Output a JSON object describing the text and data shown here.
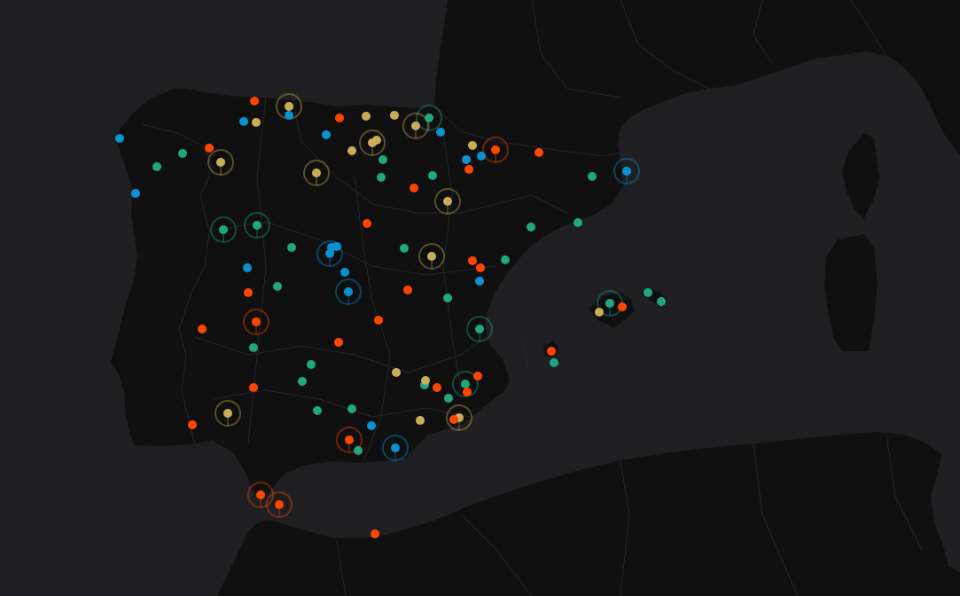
{
  "map": {
    "pins": [
      {
        "color": "#ff4500",
        "highlighted": false
      },
      {
        "color": "#c9ad57",
        "highlighted": true
      },
      {
        "color": "#0b93d1",
        "highlighted": false
      },
      {
        "color": "#c9ad57",
        "highlighted": false
      },
      {
        "color": "#c9ad57",
        "highlighted": false
      },
      {
        "color": "#ff4500",
        "highlighted": false
      },
      {
        "color": "#22a67d",
        "highlighted": true
      },
      {
        "color": "#0b93d1",
        "highlighted": false
      },
      {
        "color": "#c9ad57",
        "highlighted": false
      },
      {
        "color": "#c9ad57",
        "highlighted": true
      },
      {
        "color": "#0b93d1",
        "highlighted": false
      },
      {
        "color": "#0b93d1",
        "highlighted": false
      },
      {
        "color": "#0b93d1",
        "highlighted": false
      },
      {
        "color": "#c9ad57",
        "highlighted": false
      },
      {
        "color": "#c9ad57",
        "highlighted": true
      },
      {
        "color": "#c9ad57",
        "highlighted": false
      },
      {
        "color": "#ff4500",
        "highlighted": false
      },
      {
        "color": "#ff4500",
        "highlighted": true
      },
      {
        "color": "#c9ad57",
        "highlighted": false
      },
      {
        "color": "#ff4500",
        "highlighted": false
      },
      {
        "color": "#22a67d",
        "highlighted": false
      },
      {
        "color": "#0b93d1",
        "highlighted": false
      },
      {
        "color": "#22a67d",
        "highlighted": false
      },
      {
        "color": "#0b93d1",
        "highlighted": false
      },
      {
        "color": "#c9ad57",
        "highlighted": true
      },
      {
        "color": "#22a67d",
        "highlighted": false
      },
      {
        "color": "#ff4500",
        "highlighted": false
      },
      {
        "color": "#0b93d1",
        "highlighted": true
      },
      {
        "color": "#c9ad57",
        "highlighted": true
      },
      {
        "color": "#22a67d",
        "highlighted": false
      },
      {
        "color": "#22a67d",
        "highlighted": false
      },
      {
        "color": "#22a67d",
        "highlighted": false
      },
      {
        "color": "#ff4500",
        "highlighted": false
      },
      {
        "color": "#0b93d1",
        "highlighted": false
      },
      {
        "color": "#c9ad57",
        "highlighted": true
      },
      {
        "color": "#22a67d",
        "highlighted": false
      },
      {
        "color": "#ff4500",
        "highlighted": false
      },
      {
        "color": "#22a67d",
        "highlighted": true
      },
      {
        "color": "#22a67d",
        "highlighted": false
      },
      {
        "color": "#22a67d",
        "highlighted": true
      },
      {
        "color": "#0b93d1",
        "highlighted": false
      },
      {
        "color": "#0b93d1",
        "highlighted": false
      },
      {
        "color": "#22a67d",
        "highlighted": false
      },
      {
        "color": "#22a67d",
        "highlighted": false
      },
      {
        "color": "#0b93d1",
        "highlighted": true
      },
      {
        "color": "#c9ad57",
        "highlighted": true
      },
      {
        "color": "#ff4500",
        "highlighted": false
      },
      {
        "color": "#22a67d",
        "highlighted": false
      },
      {
        "color": "#ff4500",
        "highlighted": false
      },
      {
        "color": "#0b93d1",
        "highlighted": false
      },
      {
        "color": "#0b93d1",
        "highlighted": false
      },
      {
        "color": "#0b93d1",
        "highlighted": false
      },
      {
        "color": "#22a67d",
        "highlighted": false
      },
      {
        "color": "#ff4500",
        "highlighted": false
      },
      {
        "color": "#0b93d1",
        "highlighted": true
      },
      {
        "color": "#ff4500",
        "highlighted": false
      },
      {
        "color": "#22a67d",
        "highlighted": false
      },
      {
        "color": "#22a67d",
        "highlighted": false
      },
      {
        "color": "#22a67d",
        "highlighted": false
      },
      {
        "color": "#22a67d",
        "highlighted": true
      },
      {
        "color": "#ff4500",
        "highlighted": false
      },
      {
        "color": "#c9ad57",
        "highlighted": false
      },
      {
        "color": "#ff4500",
        "highlighted": false
      },
      {
        "color": "#ff4500",
        "highlighted": true
      },
      {
        "color": "#ff4500",
        "highlighted": false
      },
      {
        "color": "#22a67d",
        "highlighted": true
      },
      {
        "color": "#ff4500",
        "highlighted": false
      },
      {
        "color": "#22a67d",
        "highlighted": false
      },
      {
        "color": "#ff4500",
        "highlighted": false
      },
      {
        "color": "#22a67d",
        "highlighted": false
      },
      {
        "color": "#22a67d",
        "highlighted": false
      },
      {
        "color": "#c9ad57",
        "highlighted": false
      },
      {
        "color": "#ff4500",
        "highlighted": false
      },
      {
        "color": "#22a67d",
        "highlighted": false
      },
      {
        "color": "#c9ad57",
        "highlighted": false
      },
      {
        "color": "#22a67d",
        "highlighted": false
      },
      {
        "color": "#22a67d",
        "highlighted": true
      },
      {
        "color": "#ff4500",
        "highlighted": false
      },
      {
        "color": "#ff4500",
        "highlighted": false
      },
      {
        "color": "#ff4500",
        "highlighted": false
      },
      {
        "color": "#22a67d",
        "highlighted": false
      },
      {
        "color": "#22a67d",
        "highlighted": false
      },
      {
        "color": "#22a67d",
        "highlighted": false
      },
      {
        "color": "#c9ad57",
        "highlighted": true
      },
      {
        "color": "#c9ad57",
        "highlighted": true
      },
      {
        "color": "#ff4500",
        "highlighted": false
      },
      {
        "color": "#c9ad57",
        "highlighted": false
      },
      {
        "color": "#ff4500",
        "highlighted": false
      },
      {
        "color": "#0b93d1",
        "highlighted": false
      },
      {
        "color": "#ff4500",
        "highlighted": true
      },
      {
        "color": "#0b93d1",
        "highlighted": true
      },
      {
        "color": "#22a67d",
        "highlighted": false
      },
      {
        "color": "#ff4500",
        "highlighted": true
      },
      {
        "color": "#ff4500",
        "highlighted": true
      },
      {
        "color": "#ff4500",
        "highlighted": false
      }
    ]
  }
}
